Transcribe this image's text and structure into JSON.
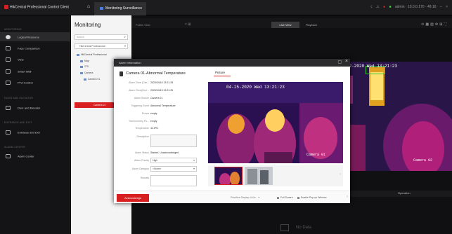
{
  "app": {
    "title": "HikCentral Professional Control Client",
    "tab_label": "Monitoring Surveillance",
    "user_text": "admin · 10.0.0.170 · 49:16"
  },
  "nav": {
    "sections": [
      "MONITORING",
      "DOOR AND ELEVATOR",
      "ENTRANCE AND EXIT",
      "ALARM CENTER"
    ],
    "items": [
      {
        "label": "Logical Resource",
        "active": true
      },
      {
        "label": "Face Comparison",
        "active": false
      },
      {
        "label": "View",
        "active": false
      },
      {
        "label": "Smart Wall",
        "active": false
      },
      {
        "label": "PTZ Control",
        "active": false
      },
      {
        "label": "Door and Elevator",
        "active": false
      },
      {
        "label": "Entrance and Exit",
        "active": false
      },
      {
        "label": "Alarm Center",
        "active": false
      }
    ]
  },
  "monitoring": {
    "title": "Monitoring",
    "search_placeholder": "Search",
    "site": "HikCentral Professional",
    "tree": [
      "HikCentral Professional",
      "Map",
      "270",
      "Camera",
      "Camera 01",
      "Camera 01"
    ]
  },
  "main": {
    "view_name": "Public View",
    "live_label": "Live View",
    "playback_label": "Playback",
    "tile_osd": "12-2020 Wed 13:21:23",
    "tile_camera": "Camera 02",
    "operation_col": "Operation",
    "no_data": "No Data"
  },
  "modal": {
    "header": "Alarm Information",
    "alarm_title": "Camera 01-Abnormal Temperature",
    "fields": [
      {
        "label": "Alarm Time (Clie...",
        "value": "2020/04/15 13:21:25"
      },
      {
        "label": "Alarm Time(Devi...",
        "value": "2020/04/15 13:21:25"
      },
      {
        "label": "Alarm Source",
        "value": "Camera 01"
      },
      {
        "label": "Triggering Event",
        "value": "Abnormal Temperature"
      },
      {
        "label": "Preset",
        "value": "empty"
      },
      {
        "label": "Thermometry Po...",
        "value": "empty"
      },
      {
        "label": "Temperature",
        "value": "42.6℃"
      }
    ],
    "description_label": "Description",
    "status_label": "Alarm Status",
    "status_value": "Started, Unacknowledged",
    "priority_label": "Alarm Priority",
    "priority_value": "High",
    "category_label": "Alarm Category",
    "category_value": "<None>",
    "remark_label": "Remark",
    "picture_tab": "Picture",
    "picture_osd": "04-15-2020 Wed 13:21:23",
    "picture_camera": "Camera 01",
    "acknowledge_label": "Acknowledge",
    "prioritize_label": "Prioritize Display of Ua...",
    "full_screen_label": "Full Screen",
    "popup_label": "Enable Pop-up Window"
  }
}
